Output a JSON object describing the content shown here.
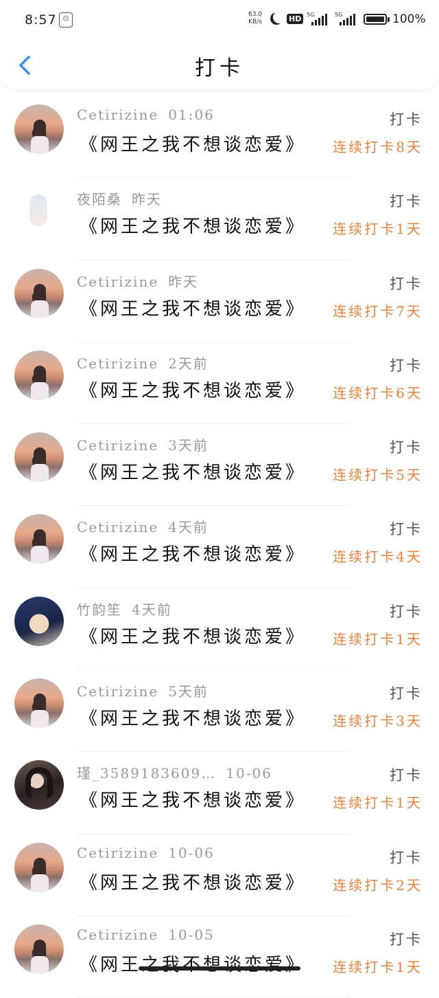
{
  "status_bar": {
    "time": "8:57",
    "notif_icon": "app-notification-icon",
    "net_speed_value": "63.0",
    "net_speed_unit": "KB/s",
    "hd_badge": "HD",
    "sig1_label": "5G",
    "sig2_label": "5G",
    "battery_pct": "100%"
  },
  "header": {
    "title": "打卡",
    "back_icon": "chevron-left-icon",
    "accent_color": "#3a8ee6"
  },
  "colors": {
    "streak": "#e8823b",
    "meta": "#9a9a9a"
  },
  "rows": [
    {
      "avatar": "sunset",
      "user": "Cetirizine",
      "when": "01:06",
      "book": "《网王之我不想谈恋爱》",
      "action": "打卡",
      "streak": "连续打卡8天"
    },
    {
      "avatar": "angel",
      "user": "夜陌桑",
      "when": "昨天",
      "book": "《网王之我不想谈恋爱》",
      "action": "打卡",
      "streak": "连续打卡1天"
    },
    {
      "avatar": "sunset",
      "user": "Cetirizine",
      "when": "昨天",
      "book": "《网王之我不想谈恋爱》",
      "action": "打卡",
      "streak": "连续打卡7天"
    },
    {
      "avatar": "sunset",
      "user": "Cetirizine",
      "when": "2天前",
      "book": "《网王之我不想谈恋爱》",
      "action": "打卡",
      "streak": "连续打卡6天"
    },
    {
      "avatar": "sunset",
      "user": "Cetirizine",
      "when": "3天前",
      "book": "《网王之我不想谈恋爱》",
      "action": "打卡",
      "streak": "连续打卡5天"
    },
    {
      "avatar": "sunset",
      "user": "Cetirizine",
      "when": "4天前",
      "book": "《网王之我不想谈恋爱》",
      "action": "打卡",
      "streak": "连续打卡4天"
    },
    {
      "avatar": "anime",
      "user": "竹韵笙",
      "when": "4天前",
      "book": "《网王之我不想谈恋爱》",
      "action": "打卡",
      "streak": "连续打卡1天"
    },
    {
      "avatar": "sunset",
      "user": "Cetirizine",
      "when": "5天前",
      "book": "《网王之我不想谈恋爱》",
      "action": "打卡",
      "streak": "连续打卡3天"
    },
    {
      "avatar": "girl",
      "user": "瑾_3589183609…",
      "when": "10-06",
      "book": "《网王之我不想谈恋爱》",
      "action": "打卡",
      "streak": "连续打卡1天"
    },
    {
      "avatar": "sunset",
      "user": "Cetirizine",
      "when": "10-06",
      "book": "《网王之我不想谈恋爱》",
      "action": "打卡",
      "streak": "连续打卡2天"
    },
    {
      "avatar": "sunset",
      "user": "Cetirizine",
      "when": "10-05",
      "book": "《网王之我不想谈恋爱》",
      "action": "打卡",
      "streak": "连续打卡1天"
    }
  ]
}
